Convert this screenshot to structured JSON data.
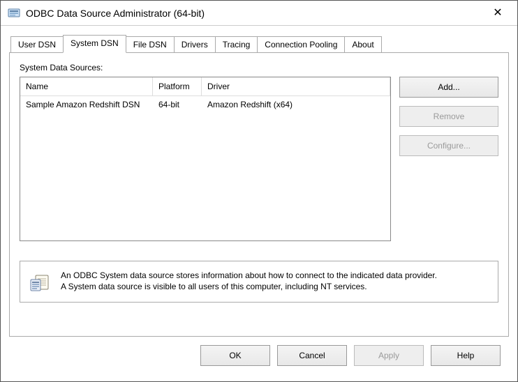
{
  "window": {
    "title": "ODBC Data Source Administrator (64-bit)"
  },
  "tabs": {
    "user_dsn": "User DSN",
    "system_dsn": "System DSN",
    "file_dsn": "File DSN",
    "drivers": "Drivers",
    "tracing": "Tracing",
    "connection_pooling": "Connection Pooling",
    "about": "About"
  },
  "panel": {
    "section_label": "System Data Sources:",
    "columns": {
      "name": "Name",
      "platform": "Platform",
      "driver": "Driver"
    },
    "rows": [
      {
        "name": "Sample Amazon Redshift DSN",
        "platform": "64-bit",
        "driver": "Amazon Redshift (x64)"
      }
    ],
    "buttons": {
      "add": "Add...",
      "remove": "Remove",
      "configure": "Configure..."
    },
    "info_line1": "An ODBC System data source stores information about how to connect to the indicated data provider.",
    "info_line2": "A System data source is visible to all users of this computer, including NT services."
  },
  "footer": {
    "ok": "OK",
    "cancel": "Cancel",
    "apply": "Apply",
    "help": "Help"
  }
}
